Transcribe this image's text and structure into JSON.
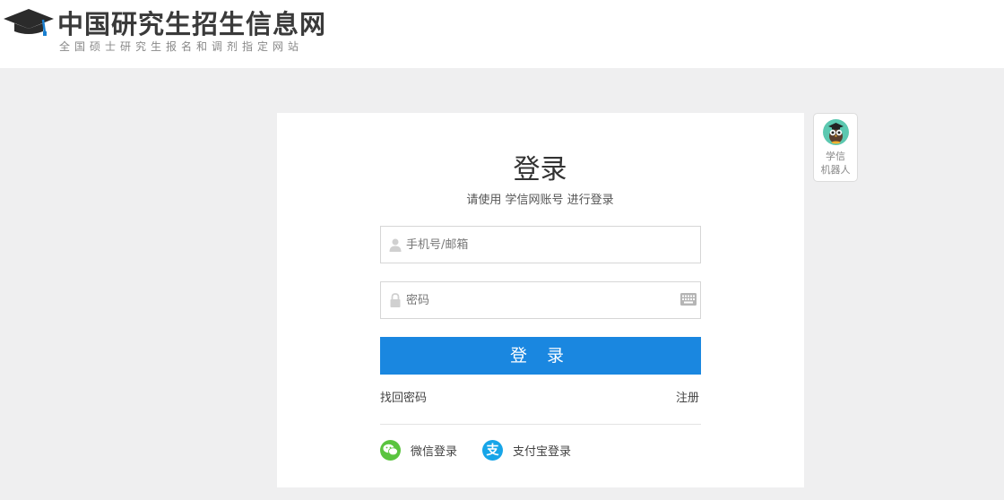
{
  "header": {
    "site_title": "中国研究生招生信息网",
    "site_subtitle": "全国硕士研究生报名和调剂指定网站"
  },
  "login": {
    "title": "登录",
    "subtitle": "请使用 学信网账号 进行登录",
    "username_placeholder": "手机号/邮箱",
    "password_placeholder": "密码",
    "login_button": "登 录",
    "forgot_password": "找回密码",
    "register": "注册",
    "wechat_login": "微信登录",
    "alipay_login": "支付宝登录",
    "alipay_glyph": "支"
  },
  "robot": {
    "line1": "学信",
    "line2": "机器人"
  },
  "colors": {
    "primary": "#1a87e0",
    "wechat": "#5ac43f",
    "alipay": "#17a5e8",
    "background": "#efeff0"
  }
}
